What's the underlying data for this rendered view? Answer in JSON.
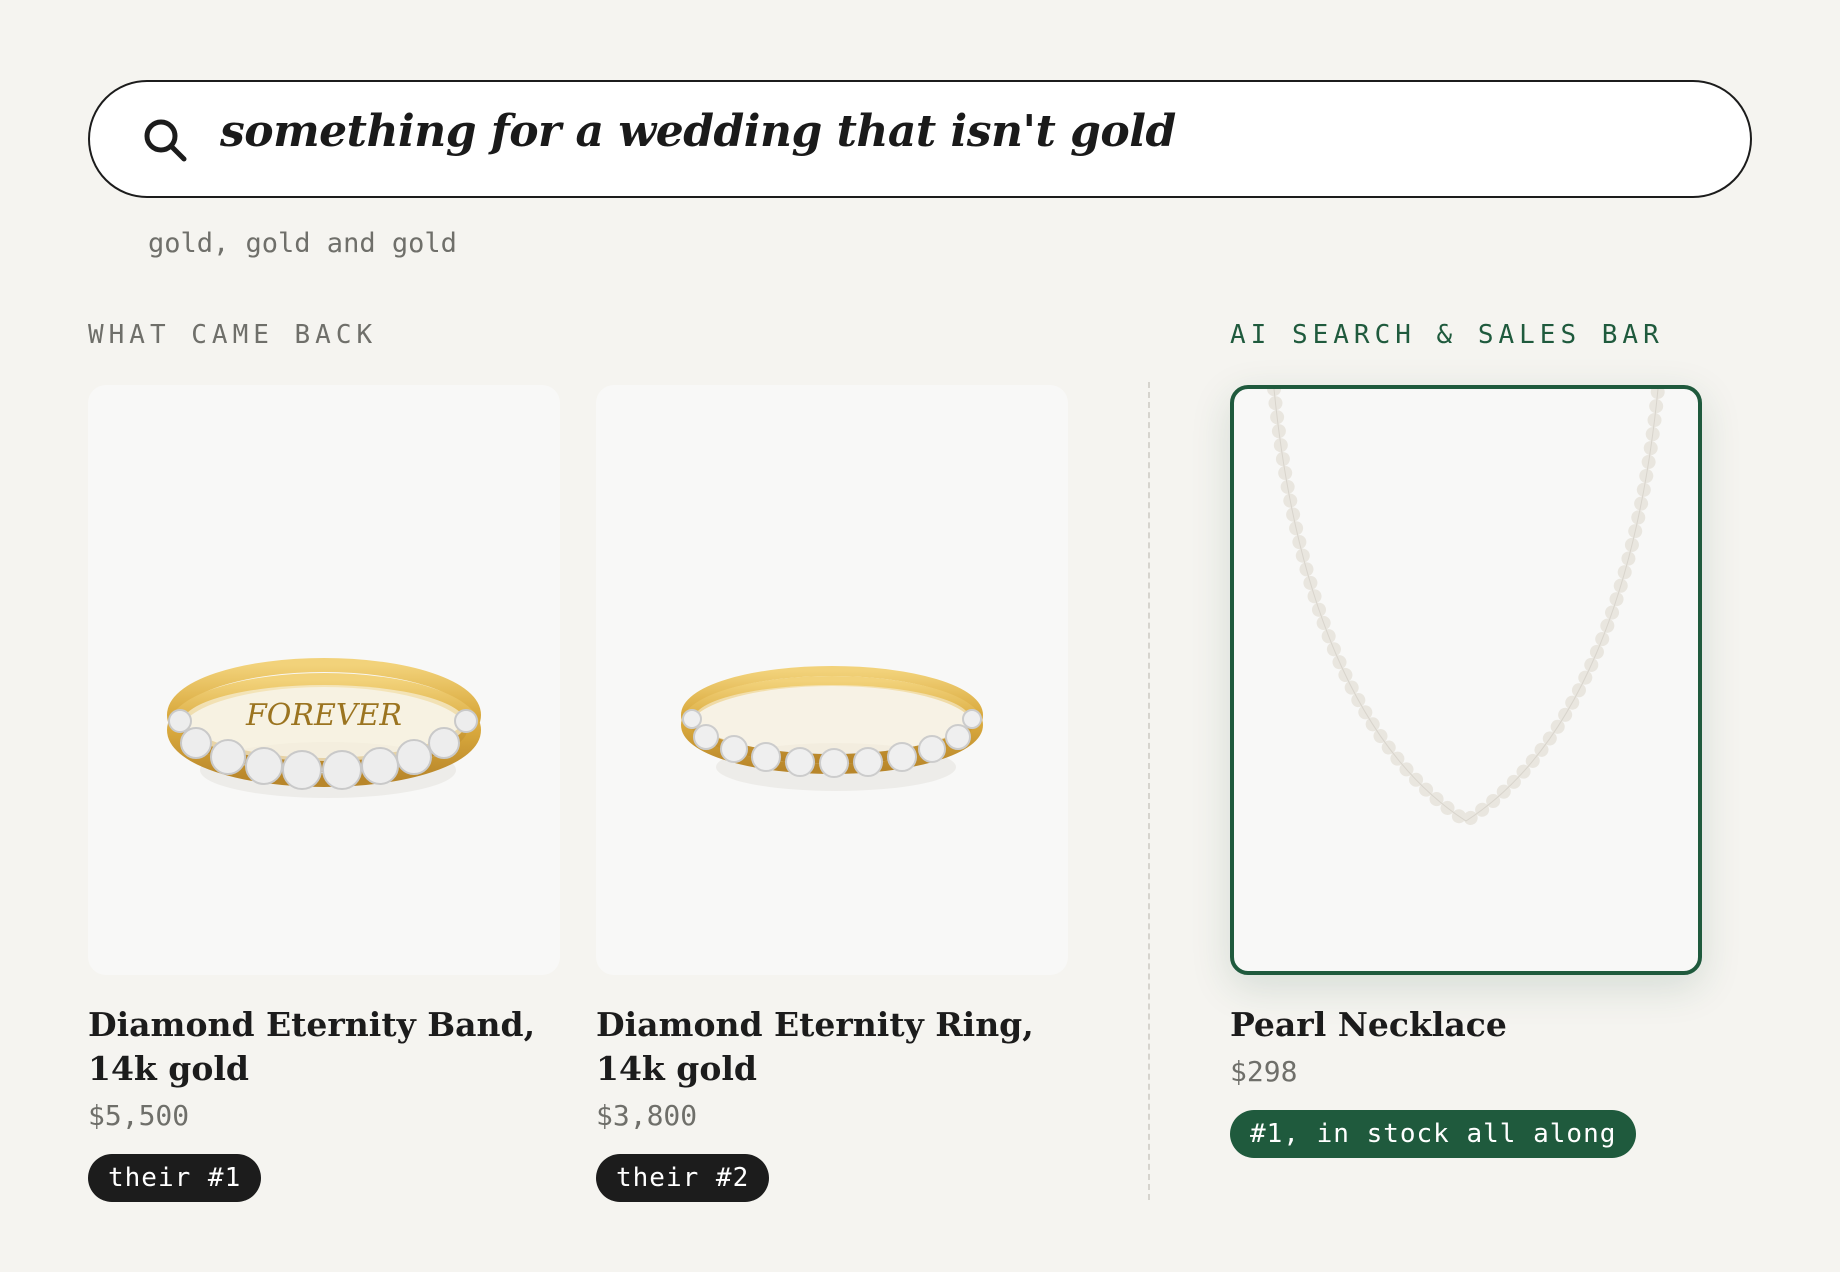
{
  "search": {
    "query": "something for a wedding that isn't gold",
    "hint": "gold, gold and gold"
  },
  "sections": {
    "left_label": "WHAT CAME BACK",
    "right_label": "AI SEARCH & SALES BAR"
  },
  "products": [
    {
      "title": "Diamond Eternity Band, 14k gold",
      "price": "$5,500",
      "badge": "their #1",
      "engraving": "FOREVER"
    },
    {
      "title": "Diamond Eternity Ring, 14k gold",
      "price": "$3,800",
      "badge": "their #2"
    },
    {
      "title": "Pearl Necklace",
      "price": "$298",
      "badge": "#1, in stock all along"
    }
  ],
  "colors": {
    "accent_green": "#1f5a3d",
    "dark": "#1c1c1c",
    "gold": "#d9b24a",
    "background": "#f5f4f0"
  },
  "icons": {
    "search": "search-icon"
  }
}
